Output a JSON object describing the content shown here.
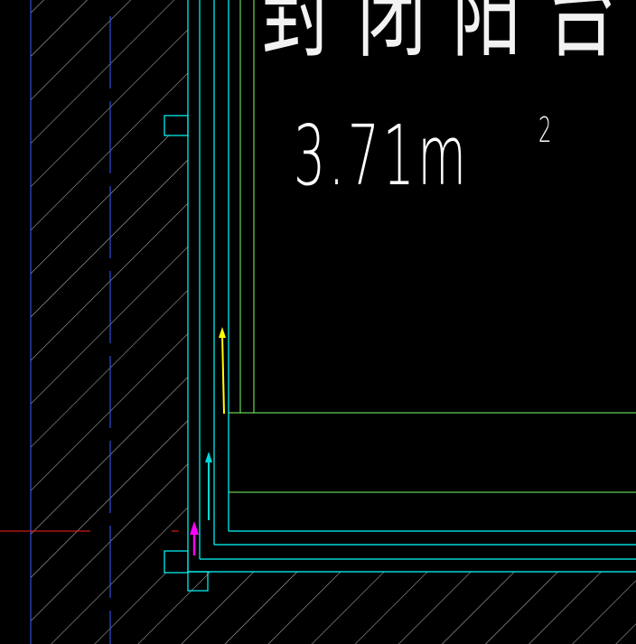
{
  "drawing": {
    "room_title": "封闭阳台",
    "area_value": "3.71m",
    "area_superscript": "2",
    "colors": {
      "background": "#000000",
      "wall_outline": "#00ffff",
      "inner_outline": "#7cff6b",
      "hatch": "#ffffff",
      "axis_line": "#3c5aff",
      "arrow_yellow": "#ffff00",
      "arrow_cyan": "#00e0e0",
      "arrow_magenta": "#ff00ff",
      "marker_red": "#ff0000",
      "text": "#ffffff"
    },
    "icons": [
      "yellow-arrow-icon",
      "cyan-arrow-icon",
      "magenta-arrow-icon"
    ]
  }
}
